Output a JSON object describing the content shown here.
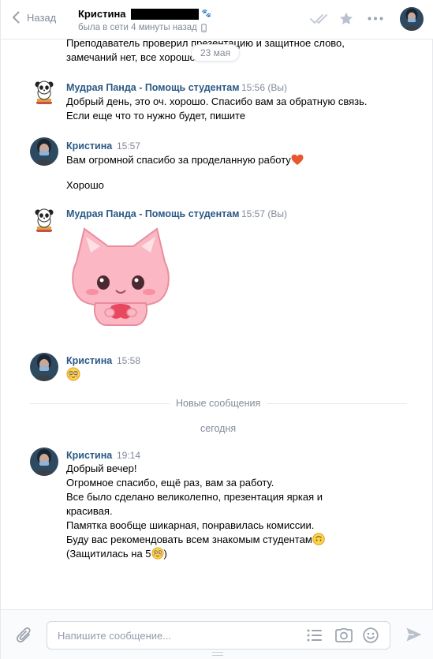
{
  "header": {
    "back_label": "Назад",
    "peer_name": "Кристина",
    "peer_status": "была в сети 4 минуты назад"
  },
  "date_pill": "23 мая",
  "messages": {
    "partial": {
      "line1": "Преподаватель проверил презентацию и защитное слово,",
      "line2": "замечаний нет, все хорошо"
    },
    "panda1": {
      "author": "Мудрая Панда - Помощь студентам",
      "time": "15:56 (Вы)",
      "line1": "Добрый день, это оч. хорошо. Спасибо вам за обратную связь.",
      "line2": "Если еще что то нужно будет, пишите"
    },
    "kristina1": {
      "author": "Кристина",
      "time": "15:57",
      "line1": "Вам огромной спасибо за проделанную работу",
      "line2": "Хорошо"
    },
    "panda2": {
      "author": "Мудрая Панда - Помощь студентам",
      "time": "15:57 (Вы)"
    },
    "kristina2": {
      "author": "Кристина",
      "time": "15:58"
    },
    "new_messages_label": "Новые сообщения",
    "today_label": "сегодня",
    "kristina3": {
      "author": "Кристина",
      "time": "19:14",
      "lines": [
        "Добрый вечер!",
        "Огромное спасибо, ещё раз, вам за работу.",
        "Все было сделано великолепно, презентация яркая и",
        "красивая.",
        "Памятка вообще шикарная, понравилась комиссии.",
        "Буду вас рекомендовать всем знакомым студентам",
        "(Защитилась на 5"
      ],
      "last_line_suffix": ")"
    }
  },
  "composer": {
    "placeholder": "Напишите сообщение..."
  },
  "icons": [
    "chevron-left-icon",
    "double-check-icon",
    "star-icon",
    "more-icon",
    "phone-icon",
    "paperclip-icon",
    "list-icon",
    "camera-icon",
    "smile-icon",
    "send-icon",
    "heart-icon",
    "blush-emoji-icon",
    "upside-down-emoji-icon"
  ]
}
